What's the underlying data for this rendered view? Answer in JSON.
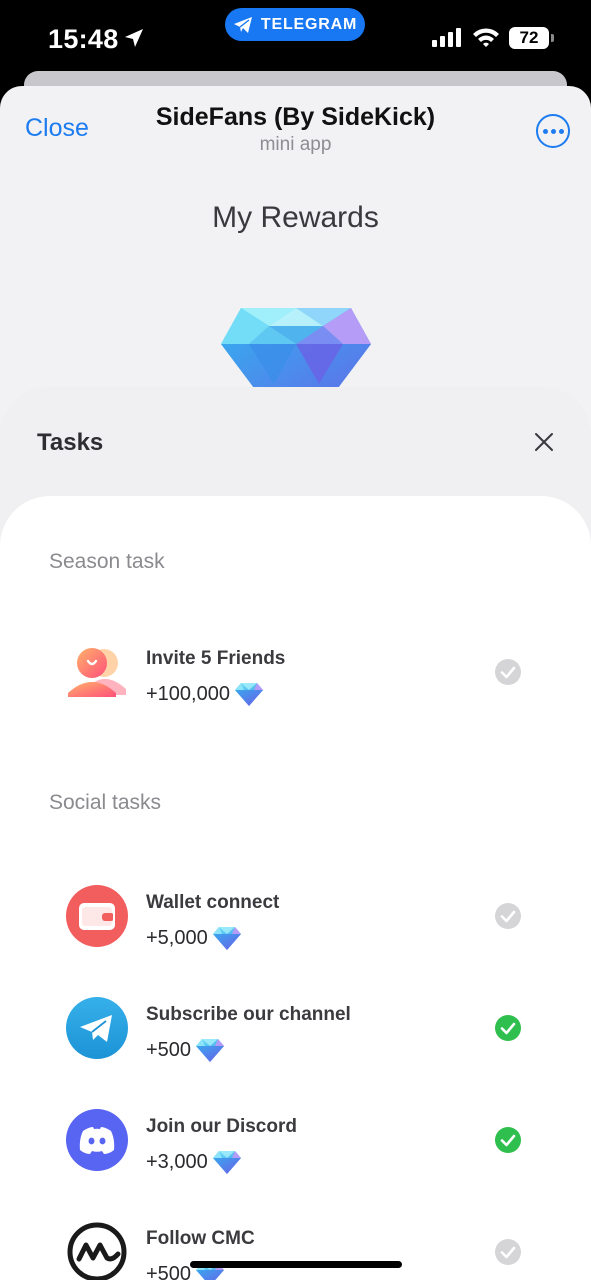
{
  "status_bar": {
    "time": "15:48",
    "pill_label": "TELEGRAM",
    "battery": "72"
  },
  "header": {
    "close_label": "Close",
    "title": "SideFans (By SideKick)",
    "subtitle": "mini app",
    "more_icon": "more-horizontal-icon"
  },
  "page": {
    "title": "My Rewards"
  },
  "tasks_panel": {
    "title": "Tasks",
    "close_icon": "close-icon",
    "season_label": "Season task",
    "social_label": "Social tasks",
    "season_tasks": [
      {
        "name": "Invite 5 Friends",
        "reward": "+100,000",
        "icon": "friends-icon",
        "completed": false
      }
    ],
    "social_tasks": [
      {
        "name": "Wallet connect",
        "reward": "+5,000",
        "icon": "wallet-icon",
        "completed": false
      },
      {
        "name": "Subscribe our channel",
        "reward": "+500",
        "icon": "telegram-icon",
        "completed": true
      },
      {
        "name": "Join our Discord",
        "reward": "+3,000",
        "icon": "discord-icon",
        "completed": true
      },
      {
        "name": "Follow CMC",
        "reward": "+500",
        "icon": "coinmarketcap-icon",
        "completed": false
      }
    ]
  },
  "colors": {
    "accent": "#1c7cf0",
    "check_done": "#2fbf4f",
    "check_pending": "#d5d5d8"
  }
}
